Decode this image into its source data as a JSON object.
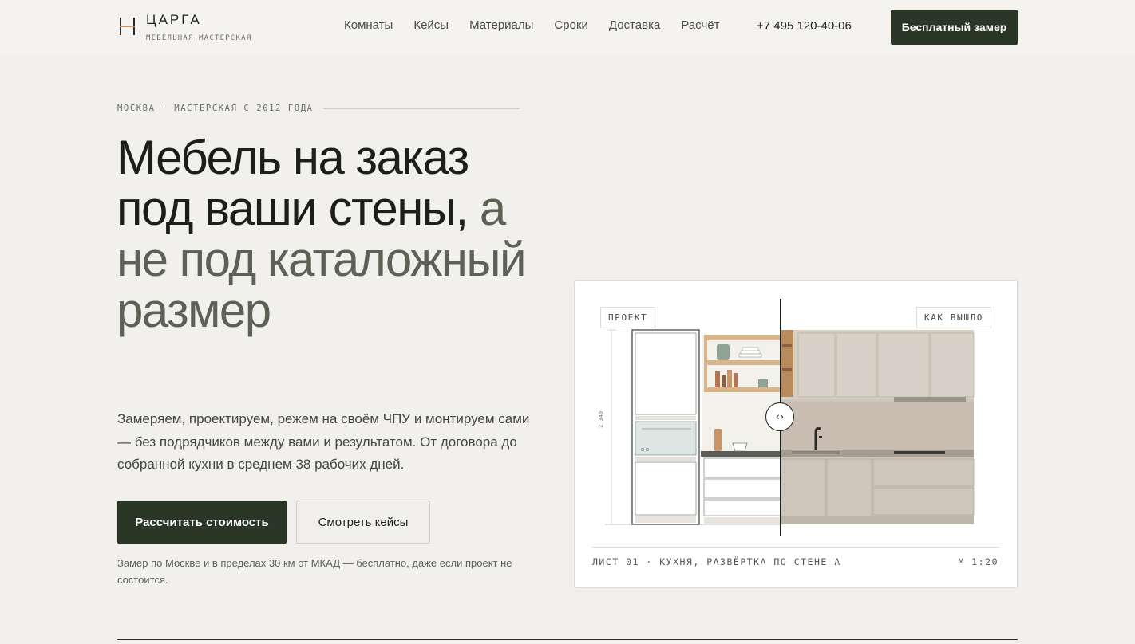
{
  "brand": {
    "name": "ЦАРГА",
    "subtitle": "МЕБЕЛЬНАЯ МАСТЕРСКАЯ"
  },
  "nav": {
    "items": [
      "Комнаты",
      "Кейсы",
      "Материалы",
      "Сроки",
      "Доставка",
      "Расчёт"
    ]
  },
  "header": {
    "phone": "+7 495 120-40-06",
    "cta": "Бесплатный замер"
  },
  "hero": {
    "eyebrow": "МОСКВА · МАСТЕРСКАЯ С 2012 ГОДА",
    "headline_dark": "Мебель на заказ под ваши стены,",
    "headline_muted": "а не под каталожный размер",
    "lead": "Замеряем, проектируем, режем на своём ЧПУ и монтируем сами — без подрядчиков между вами и результатом. От договора до собранной кухни в среднем 38 рабочих дней.",
    "primary_button": "Рассчитать стоимость",
    "secondary_button": "Смотреть кейсы",
    "note": "Замер по Москве и в пределах 30 км от МКАД — бесплатно, даже если проект не состоится."
  },
  "comparison": {
    "label_left": "ПРОЕКТ",
    "label_right": "КАК ВЫШЛО",
    "dimension": "2 340",
    "caption": "ЛИСТ 01 · КУХНЯ, РАЗВЁРТКА ПО СТЕНЕ А",
    "scale": "М 1:20",
    "handle_icon": "compare-arrows-icon"
  },
  "colors": {
    "accent": "#2a3626",
    "background": "#f1f0ec",
    "wood": "#c9956a"
  }
}
